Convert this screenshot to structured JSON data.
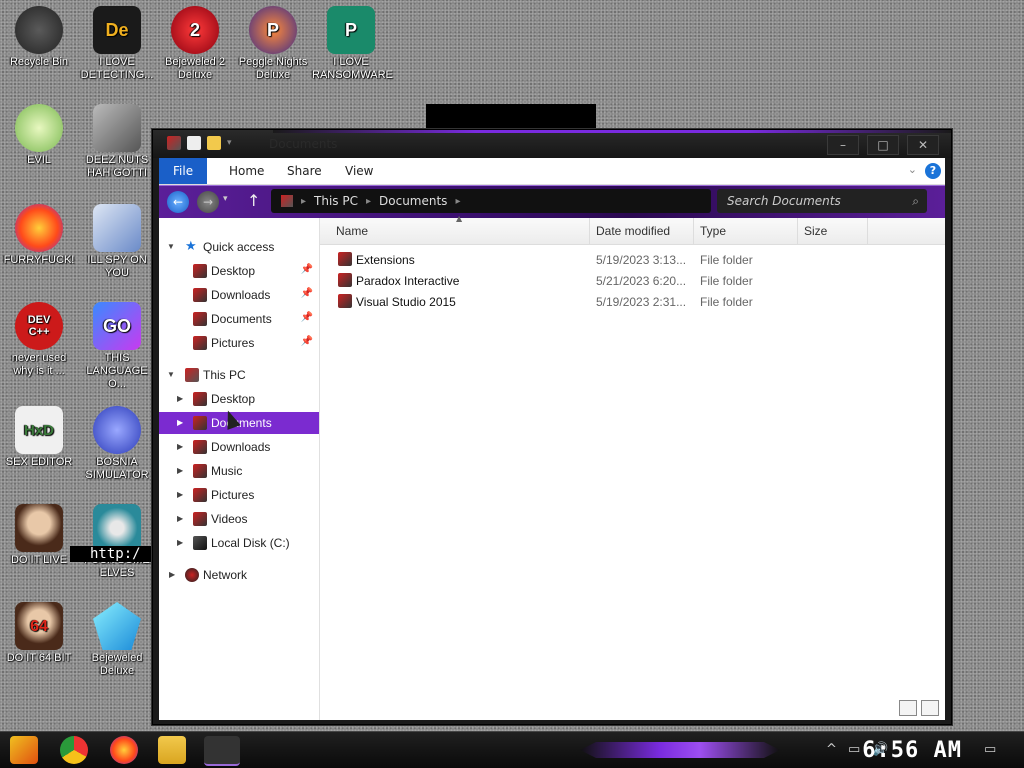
{
  "desktop_icons": [
    {
      "label": "Recycle Bin",
      "icon": "recycle-bin-icon",
      "color": "#3a3a3a",
      "glyph": ""
    },
    {
      "label": "I LOVE\nDETECTING...",
      "icon": "detect-it-easy-icon",
      "color": "#1a1a1a",
      "glyph": "De"
    },
    {
      "label": "Bejeweled 2\nDeluxe",
      "icon": "bejeweled-2-icon",
      "color": "#c8001f",
      "glyph": "2"
    },
    {
      "label": "Peggle Nights\nDeluxe",
      "icon": "peggle-nights-icon",
      "color": "#e0561a",
      "glyph": "P"
    },
    {
      "label": "I LOVE\nRANSOMWARE",
      "icon": "ransomware-icon",
      "color": "#0f7a5a",
      "glyph": "P"
    },
    {
      "label": "EVIL",
      "icon": "evil-icon",
      "color": "#cfe8a0",
      "glyph": ""
    },
    {
      "label": "DEEZ NUTS\nHAH GOTTI",
      "icon": "deez-nuts-icon",
      "color": "#7a7a7a",
      "glyph": ""
    },
    {
      "label": "FURRYFUCK!",
      "icon": "firefox-icon",
      "color": "#ff6a1a",
      "glyph": ""
    },
    {
      "label": "ILL SPY ON\nYOU",
      "icon": "spy-icon",
      "color": "#4a7abf",
      "glyph": ""
    },
    {
      "label": "never used\nwhy is it ...",
      "icon": "dev-cpp-icon",
      "color": "#cc1a1a",
      "glyph": "DEV\nC++"
    },
    {
      "label": "THIS\nLANGUAGE O...",
      "icon": "goland-icon",
      "color": "#1a1a1a",
      "glyph": "GO"
    },
    {
      "label": "SEX EDITOR",
      "icon": "hxd-icon",
      "color": "#e8e8e8",
      "glyph": "HxD"
    },
    {
      "label": "BOSNIA\nSIMULATOR",
      "icon": "bosnia-simulator-icon",
      "color": "#4a5ad8",
      "glyph": ""
    },
    {
      "label": "DO IT LIVE",
      "icon": "portrait-icon",
      "color": "#6a4a3a",
      "glyph": ""
    },
    {
      "label": "FUCK SOME\nELVES",
      "icon": "elves-icon",
      "color": "#2a7a8a",
      "glyph": ""
    },
    {
      "label": "DO IT 64 BIT",
      "icon": "portrait-64-icon",
      "color": "#6a4a3a",
      "glyph": "64"
    },
    {
      "label": "Bejeweled\nDeluxe",
      "icon": "bejeweled-icon",
      "color": "#1ab8e0",
      "glyph": ""
    }
  ],
  "desktop_overlay_text": "http:/",
  "window": {
    "title": "Documents",
    "tabs": [
      "File",
      "Home",
      "Share",
      "View"
    ],
    "help": "?",
    "address": [
      "This PC",
      "Documents"
    ],
    "search_placeholder": "Search Documents",
    "controls": {
      "minimize": "–",
      "maximize": "□",
      "close": "✕"
    }
  },
  "sidebar": {
    "quick_access": {
      "label": "Quick access",
      "items": [
        "Desktop",
        "Downloads",
        "Documents",
        "Pictures"
      ]
    },
    "this_pc": {
      "label": "This PC",
      "items": [
        "Desktop",
        "Documents",
        "Downloads",
        "Music",
        "Pictures",
        "Videos",
        "Local Disk (C:)"
      ],
      "selected": "Documents"
    },
    "network": "Network"
  },
  "columns": [
    "Name",
    "Date modified",
    "Type",
    "Size"
  ],
  "files": [
    {
      "name": "Extensions",
      "date": "5/19/2023 3:13...",
      "type": "File folder",
      "size": ""
    },
    {
      "name": "Paradox Interactive",
      "date": "5/21/2023 6:20...",
      "type": "File folder",
      "size": ""
    },
    {
      "name": "Visual Studio 2015",
      "date": "5/19/2023 2:31...",
      "type": "File folder",
      "size": ""
    }
  ],
  "taskbar": {
    "clock": "6:56 AM",
    "apps": [
      "start-icon",
      "chrome-icon",
      "firefox-icon",
      "file-explorer-icon",
      "explorer-window-icon"
    ]
  },
  "colors": {
    "accent": "#7b2bd0",
    "file_tab": "#1a5fc8"
  }
}
